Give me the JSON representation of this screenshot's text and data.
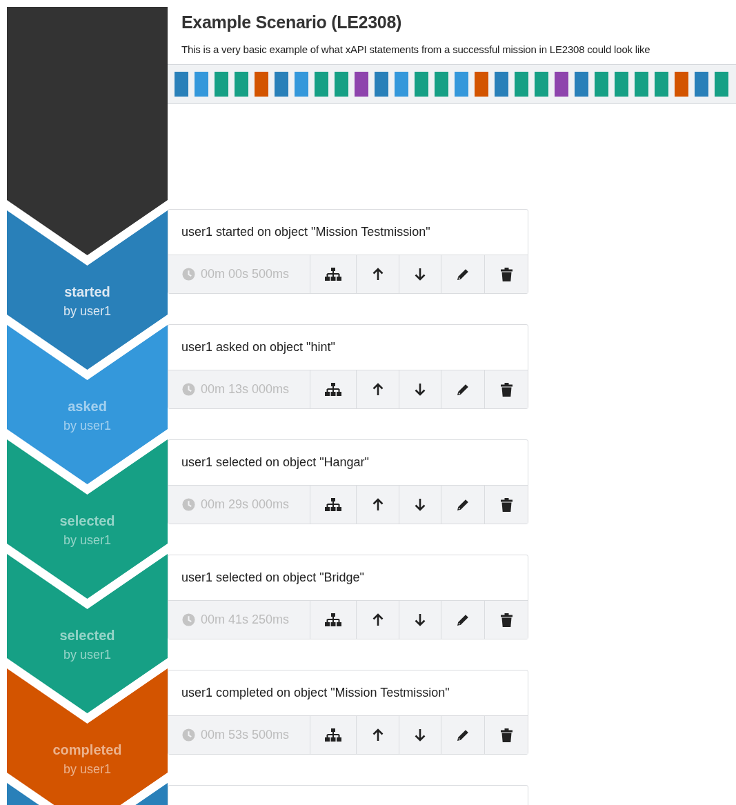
{
  "title": "Example Scenario (LE2308)",
  "description": "This is a very basic example of what xAPI statements from a successful mission in LE2308 could look like",
  "strip": [
    {
      "color": "#2980b9"
    },
    {
      "color": "#3498db"
    },
    {
      "color": "#16a085"
    },
    {
      "color": "#16a085"
    },
    {
      "color": "#d35400"
    },
    {
      "color": "#2980b9"
    },
    {
      "color": "#3498db"
    },
    {
      "color": "#16a085"
    },
    {
      "color": "#16a085"
    },
    {
      "color": "#8e44ad"
    },
    {
      "color": "#2980b9"
    },
    {
      "color": "#3498db"
    },
    {
      "color": "#16a085"
    },
    {
      "color": "#16a085"
    },
    {
      "color": "#3498db"
    },
    {
      "color": "#d35400"
    },
    {
      "color": "#2980b9"
    },
    {
      "color": "#16a085"
    },
    {
      "color": "#16a085"
    },
    {
      "color": "#8e44ad"
    },
    {
      "color": "#2980b9"
    },
    {
      "color": "#16a085"
    },
    {
      "color": "#16a085"
    },
    {
      "color": "#16a085"
    },
    {
      "color": "#16a085"
    },
    {
      "color": "#d35400"
    },
    {
      "color": "#2980b9"
    },
    {
      "color": "#16a085"
    }
  ],
  "steps": [
    {
      "verb": "started",
      "actor": "by user1",
      "selected": true,
      "color": "#2980b9",
      "statement": "user1 started on object \"Mission Testmission\"",
      "time": "00m 00s 500ms"
    },
    {
      "verb": "asked",
      "actor": "by user1",
      "selected": false,
      "color": "#3498db",
      "statement": "user1 asked on object \"hint\"",
      "time": "00m 13s 000ms"
    },
    {
      "verb": "selected",
      "actor": "by user1",
      "selected": false,
      "color": "#16a085",
      "statement": "user1 selected on object \"Hangar\"",
      "time": "00m 29s 000ms"
    },
    {
      "verb": "selected",
      "actor": "by user1",
      "selected": false,
      "color": "#16a085",
      "statement": "user1 selected on object \"Bridge\"",
      "time": "00m 41s 250ms"
    },
    {
      "verb": "completed",
      "actor": "by user1",
      "selected": false,
      "color": "#d35400",
      "statement": "user1 completed on object \"Mission Testmission\"",
      "time": "00m 53s 500ms"
    },
    {
      "color": "#2980b9"
    }
  ]
}
